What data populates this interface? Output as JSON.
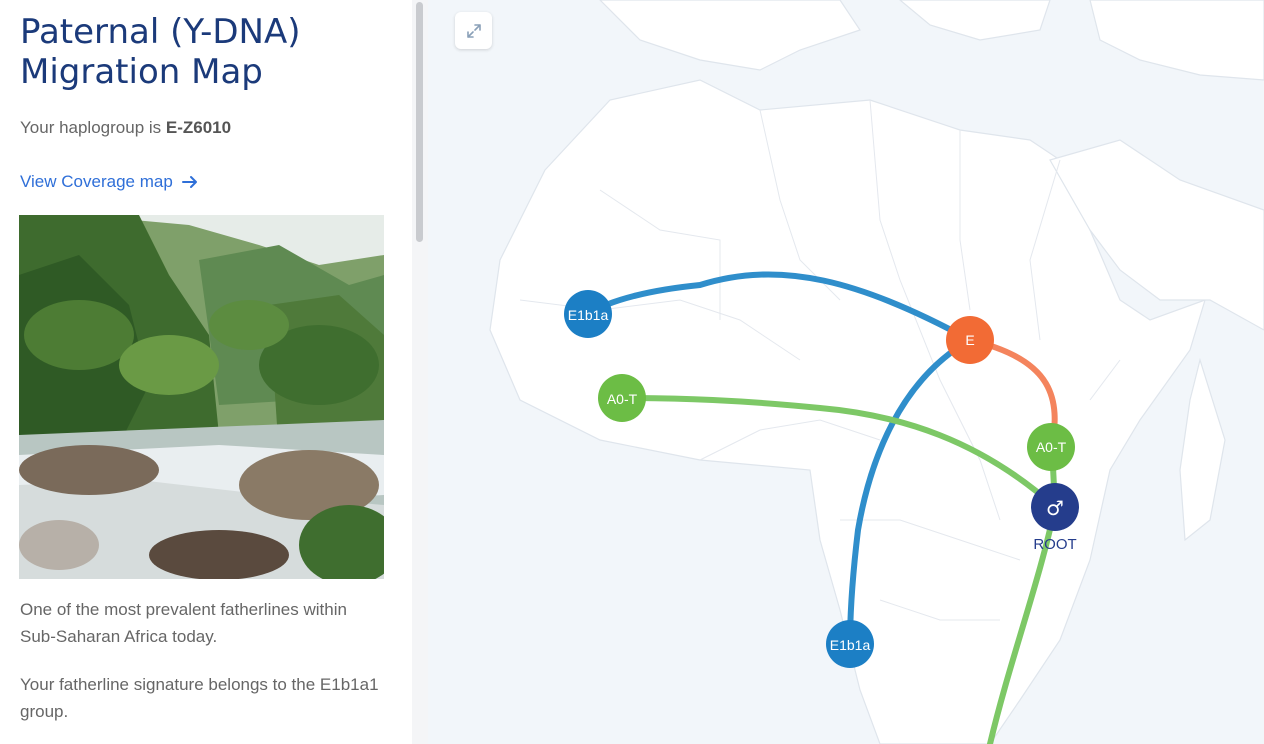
{
  "sidebar": {
    "title": "Paternal (Y-DNA) Migration Map",
    "haplogroup_prefix": "Your haplogroup is ",
    "haplogroup": "E-Z6010",
    "coverage_link": "View Coverage map",
    "description_1": "One of the most prevalent fatherlines within Sub-Saharan Africa today.",
    "description_2": "Your fatherline signature belongs to the E1b1a1 group."
  },
  "map": {
    "expand_icon": "expand-icon",
    "route_colors": {
      "blue": "#2f8ecb",
      "green": "#7dc866",
      "orange": "#f4845d"
    },
    "nodes": {
      "e1b1a_west": "E1b1a",
      "e": "E",
      "a0t_west": "A0-T",
      "a0t_east": "A0-T",
      "root_symbol": "♂",
      "root_label": "ROOT",
      "e1b1a_south": "E1b1a"
    },
    "node_colors": {
      "e1b1a": "#1c7fc5",
      "e": "#f26b35",
      "a0t": "#6cbd45",
      "root": "#253d8c"
    }
  }
}
